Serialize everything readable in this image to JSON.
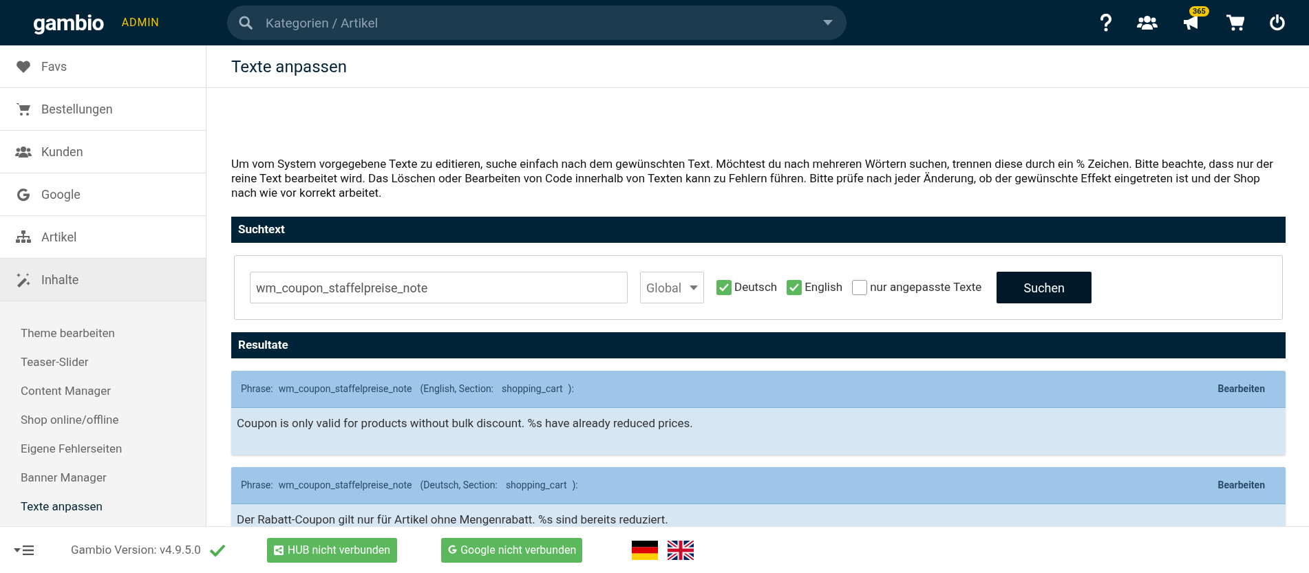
{
  "header": {
    "logo": "gambio",
    "logo_suffix": "ADMIN",
    "search": {
      "placeholder": "Kategorien / Artikel"
    },
    "notification_count": "365"
  },
  "sidebar": {
    "items": [
      {
        "label": "Favs",
        "kind": "heart",
        "selected": false
      },
      {
        "label": "Bestellungen",
        "kind": "cart",
        "selected": false
      },
      {
        "label": "Kunden",
        "kind": "users",
        "selected": false
      },
      {
        "label": "Google",
        "kind": "google",
        "selected": false
      },
      {
        "label": "Artikel",
        "kind": "sitemap",
        "selected": false
      },
      {
        "label": "Inhalte",
        "kind": "wand",
        "selected": true,
        "children": [
          {
            "label": "Theme bearbeiten",
            "selected": false
          },
          {
            "label": "Teaser-Slider",
            "selected": false
          },
          {
            "label": "Content Manager",
            "selected": false
          },
          {
            "label": "Shop online/offline",
            "selected": false
          },
          {
            "label": "Eigene Fehlerseiten",
            "selected": false
          },
          {
            "label": "Banner Manager",
            "selected": false
          },
          {
            "label": "Texte anpassen",
            "selected": true
          }
        ]
      }
    ]
  },
  "page_title": "Texte anpassen",
  "intro": "Um vom System vorgegebene Texte zu editieren, suche einfach nach dem gewünschten Text. Möchtest du nach mehreren Wörtern suchen, trennen diese durch ein % Zeichen. Bitte beachte, dass nur der reine Text bearbeitet wird. Das Löschen oder Bearbeiten von Code innerhalb von Texten kann zu Fehlern führen. Bitte prüfe nach jeder Änderung, ob der gewünschte Effekt eingetreten ist und der Shop nach wie vor korrekt arbeitet.",
  "search_section": {
    "title": "Suchtext",
    "query": "wm_coupon_staffelpreise_note",
    "scope": "Global",
    "checkboxes": [
      {
        "label": "Deutsch",
        "checked": true
      },
      {
        "label": "English",
        "checked": true
      },
      {
        "label": "nur angepasste Texte",
        "checked": false
      }
    ],
    "button": "Suchen"
  },
  "results_section": {
    "title": "Resultate",
    "results": [
      {
        "phrase_label": "Phrase:",
        "phrase": "wm_coupon_staffelpreise_note",
        "language": "(English, Section:",
        "section": "shopping_cart",
        "close": "):",
        "action": "Bearbeiten",
        "text": "Coupon is only valid for products without bulk discount. %s have already reduced prices."
      },
      {
        "phrase_label": "Phrase:",
        "phrase": "wm_coupon_staffelpreise_note",
        "language": "(Deutsch, Section:",
        "section": "shopping_cart",
        "close": "):",
        "action": "Bearbeiten",
        "text": "Der Rabatt-Coupon gilt nur für Artikel ohne Mengenrabatt. %s sind bereits reduziert."
      }
    ]
  },
  "footer": {
    "version": "Gambio Version: v4.9.5.0",
    "hub": "HUB nicht verbunden",
    "google": "Google nicht verbunden"
  }
}
